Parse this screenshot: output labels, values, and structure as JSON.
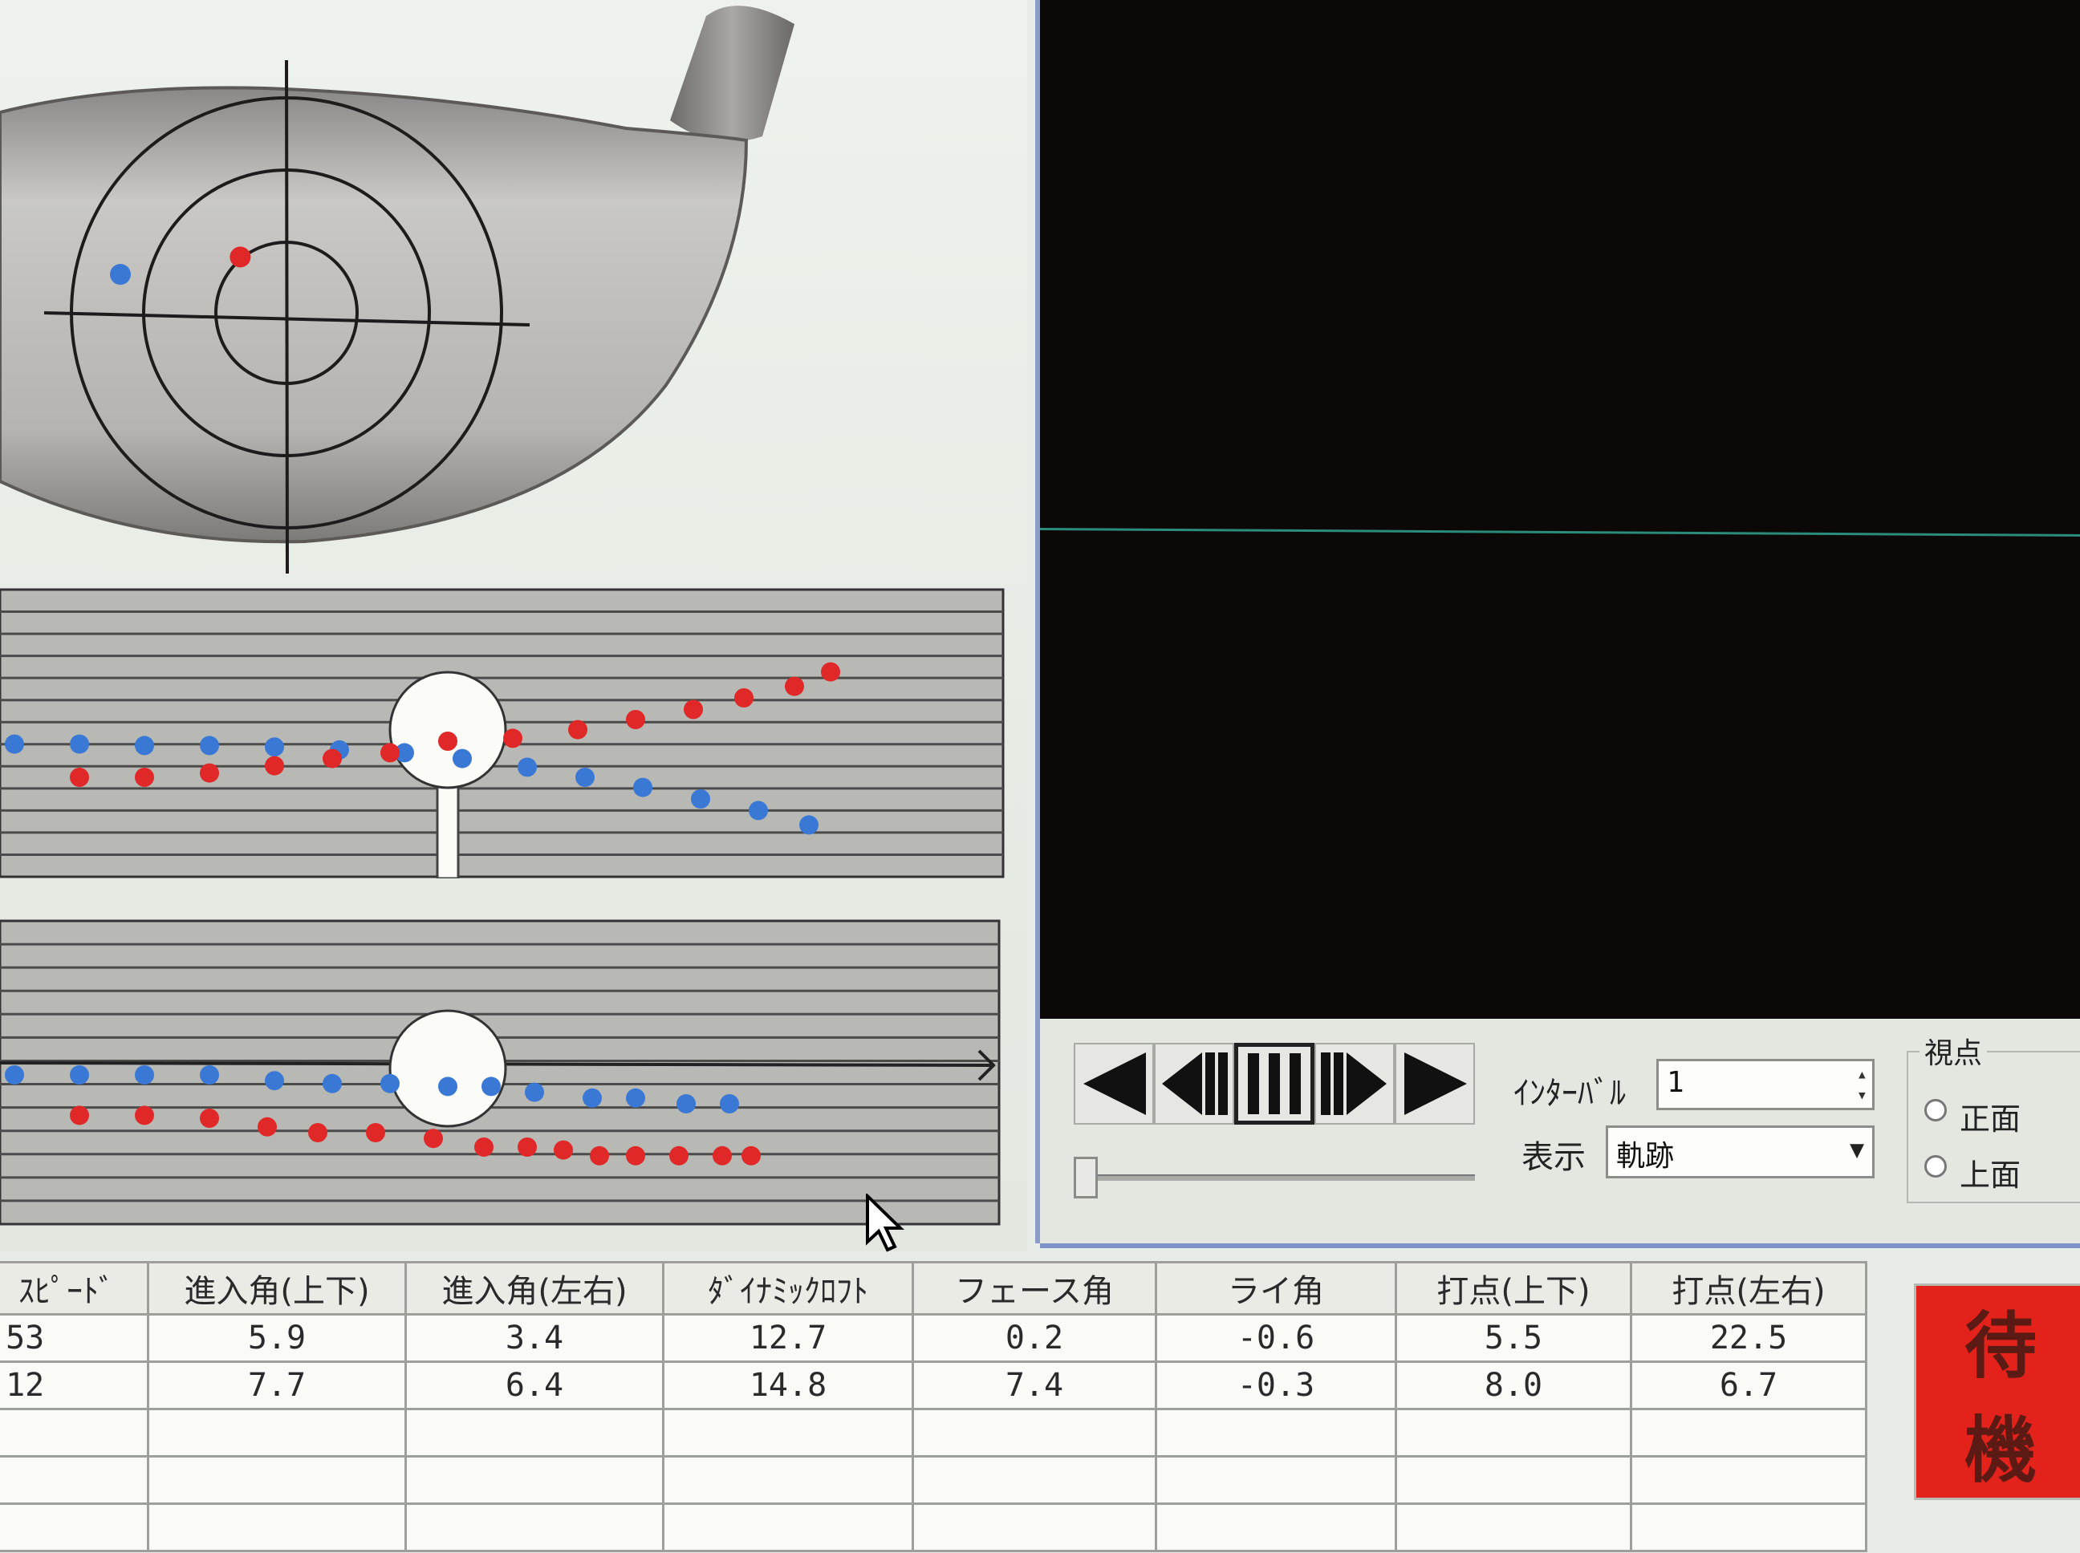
{
  "controls": {
    "interval_label": "ｲﾝﾀｰﾊﾞﾙ",
    "interval_value": "1",
    "display_label": "表示",
    "display_value": "軌跡",
    "viewpoint_label": "視点",
    "viewpoint_options": [
      "正面",
      "上面"
    ],
    "playback_icons": [
      "play-reverse-icon",
      "step-back-icon",
      "pause-icon",
      "step-forward-icon",
      "play-icon"
    ]
  },
  "table": {
    "headers": [
      "ｽﾋﾟｰﾄﾞ",
      "進入角(上下)",
      "進入角(左右)",
      "ﾀﾞｲﾅﾐｯｸﾛﾌﾄ",
      "フェース角",
      "ライ角",
      "打点(上下)",
      "打点(左右)"
    ],
    "rows": [
      [
        ".53",
        "5.9",
        "3.4",
        "12.7",
        "0.2",
        "-0.6",
        "5.5",
        "22.5"
      ],
      [
        ".12",
        "7.7",
        "6.4",
        "14.8",
        "7.4",
        "-0.3",
        "8.0",
        "6.7"
      ]
    ]
  },
  "status_button": "待機",
  "colors": {
    "series_a": "#3a78d6",
    "series_b": "#e02828",
    "standby": "#e3231b"
  },
  "chart_data": [
    {
      "type": "scatter",
      "series": [
        {
          "points": [
            [
              -115,
              60
            ]
          ]
        },
        {
          "points": [
            [
              -32,
              72
            ]
          ]
        }
      ]
    },
    {
      "type": "scatter",
      "series": [
        {
          "points": [
            [
              -300,
              18
            ],
            [
              -255,
              18
            ],
            [
              -210,
              17
            ],
            [
              -165,
              17
            ],
            [
              -120,
              16
            ],
            [
              -75,
              14
            ],
            [
              -30,
              12
            ],
            [
              10,
              8
            ],
            [
              55,
              2
            ],
            [
              95,
              -5
            ],
            [
              135,
              -12
            ],
            [
              175,
              -20
            ],
            [
              215,
              -28
            ],
            [
              250,
              -38
            ]
          ]
        },
        {
          "points": [
            [
              -255,
              -5
            ],
            [
              -210,
              -5
            ],
            [
              -165,
              -2
            ],
            [
              -120,
              3
            ],
            [
              -80,
              8
            ],
            [
              -40,
              12
            ],
            [
              0,
              20
            ],
            [
              45,
              22
            ],
            [
              90,
              28
            ],
            [
              130,
              35
            ],
            [
              170,
              42
            ],
            [
              205,
              50
            ],
            [
              240,
              58
            ],
            [
              265,
              68
            ]
          ]
        }
      ]
    },
    {
      "type": "scatter",
      "series": [
        {
          "points": [
            [
              -300,
              100
            ],
            [
              -255,
              100
            ],
            [
              -210,
              100
            ],
            [
              -165,
              100
            ],
            [
              -120,
              96
            ],
            [
              -80,
              94
            ],
            [
              -40,
              94
            ],
            [
              0,
              92
            ],
            [
              30,
              92
            ],
            [
              60,
              88
            ],
            [
              100,
              84
            ],
            [
              130,
              84
            ],
            [
              165,
              80
            ],
            [
              195,
              80
            ]
          ]
        },
        {
          "points": [
            [
              -255,
              72
            ],
            [
              -210,
              72
            ],
            [
              -165,
              70
            ],
            [
              -125,
              64
            ],
            [
              -90,
              60
            ],
            [
              -50,
              60
            ],
            [
              -10,
              56
            ],
            [
              25,
              50
            ],
            [
              55,
              50
            ],
            [
              80,
              48
            ],
            [
              105,
              44
            ],
            [
              130,
              44
            ],
            [
              160,
              44
            ],
            [
              190,
              44
            ],
            [
              210,
              44
            ]
          ]
        }
      ]
    }
  ]
}
